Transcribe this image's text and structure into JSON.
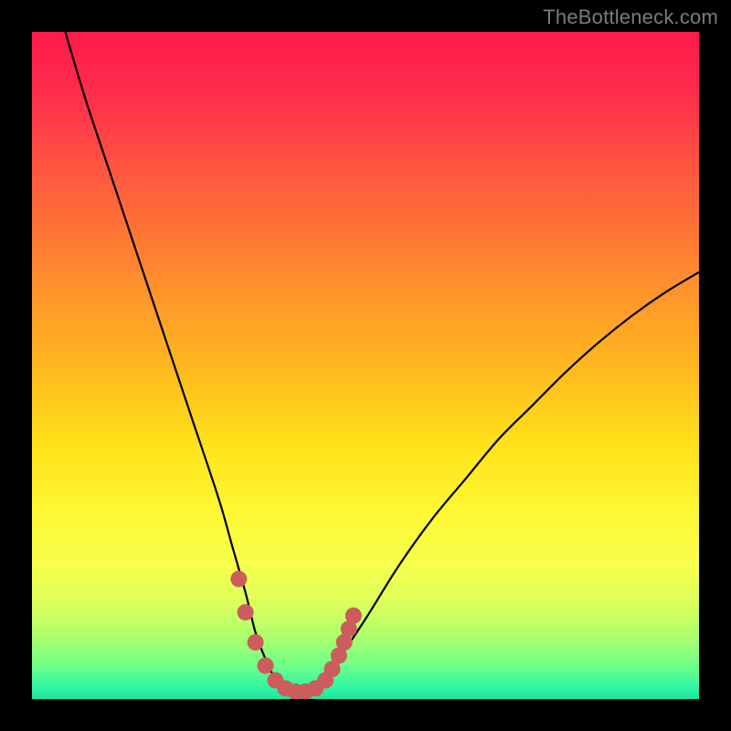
{
  "watermark": "TheBottleneck.com",
  "gradient": {
    "stops": [
      {
        "offset": 0.0,
        "color": "#ff1a4d"
      },
      {
        "offset": 0.1,
        "color": "#ff2f4a"
      },
      {
        "offset": 0.22,
        "color": "#ff5a3e"
      },
      {
        "offset": 0.36,
        "color": "#ff8a2e"
      },
      {
        "offset": 0.5,
        "color": "#ffb81f"
      },
      {
        "offset": 0.62,
        "color": "#ffe21a"
      },
      {
        "offset": 0.72,
        "color": "#fff833"
      },
      {
        "offset": 0.8,
        "color": "#f6ff4d"
      },
      {
        "offset": 0.86,
        "color": "#d9ff5c"
      },
      {
        "offset": 0.91,
        "color": "#a8ff6e"
      },
      {
        "offset": 0.95,
        "color": "#6eff88"
      },
      {
        "offset": 0.98,
        "color": "#35f7a0"
      },
      {
        "offset": 1.0,
        "color": "#18e9a2"
      }
    ]
  },
  "chart_data": {
    "type": "line",
    "title": "",
    "xlabel": "",
    "ylabel": "",
    "xlim": [
      0,
      100
    ],
    "ylim": [
      0,
      100
    ],
    "series": [
      {
        "name": "curve",
        "x": [
          5,
          8,
          12,
          16,
          20,
          24,
          28,
          30,
          32,
          33.5,
          35,
          36.5,
          38,
          40,
          42,
          44,
          46,
          50,
          55,
          60,
          65,
          70,
          75,
          80,
          85,
          90,
          95,
          100
        ],
        "y": [
          100,
          90,
          78,
          66,
          54,
          42,
          30,
          23,
          16,
          10,
          6,
          3,
          1.5,
          1,
          1.5,
          3,
          6,
          12,
          20,
          27,
          33,
          39,
          44,
          49,
          53.5,
          57.5,
          61,
          64
        ]
      }
    ],
    "highlight_points": {
      "name": "markers",
      "color": "#cd5c5c",
      "x": [
        31,
        32,
        33.5,
        35,
        36.5,
        38,
        39.5,
        41,
        42.5,
        44,
        45,
        46,
        46.8,
        47.5,
        48.2
      ],
      "y": [
        18,
        13,
        8.5,
        5,
        2.8,
        1.6,
        1.1,
        1.1,
        1.6,
        2.8,
        4.5,
        6.5,
        8.5,
        10.5,
        12.5
      ]
    }
  }
}
